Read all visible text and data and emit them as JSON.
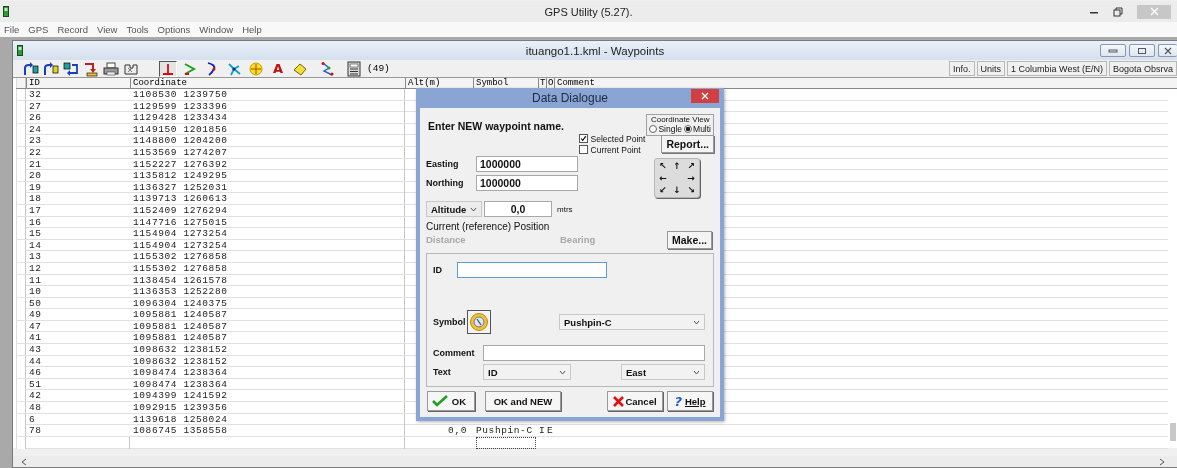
{
  "app": {
    "title": "GPS Utility (5.27).",
    "menu": [
      "File",
      "GPS",
      "Record",
      "View",
      "Tools",
      "Options",
      "Window",
      "Help"
    ]
  },
  "document": {
    "title": "ituango1.1.kml - Waypoints",
    "toolbar": {
      "modes": [
        {
          "kind": "waypoint",
          "selected": true
        },
        {
          "kind": "route",
          "selected": false
        },
        {
          "kind": "track",
          "selected": false
        },
        {
          "kind": "network",
          "selected": false
        },
        {
          "kind": "target",
          "selected": false
        },
        {
          "kind": "text",
          "label": "A",
          "selected": false
        },
        {
          "kind": "area",
          "selected": false
        }
      ],
      "count": "(49)",
      "info_buttons": [
        "Info.",
        "Units",
        "1 Columbia West (E/N)",
        "Bogota Obsrva"
      ]
    },
    "table": {
      "columns": [
        "ID",
        "Coordinate",
        "Alt(m)",
        "Symbol",
        "T",
        "O",
        "Comment"
      ],
      "rows": [
        {
          "id": "32",
          "coordinate": "1108530 1239750"
        },
        {
          "id": "27",
          "coordinate": "1129599 1233396"
        },
        {
          "id": "26",
          "coordinate": "1129428 1233434"
        },
        {
          "id": "24",
          "coordinate": "1149150 1201856"
        },
        {
          "id": "23",
          "coordinate": "1148800 1204200"
        },
        {
          "id": "22",
          "coordinate": "1153569 1274207"
        },
        {
          "id": "21",
          "coordinate": "1152227 1276392"
        },
        {
          "id": "20",
          "coordinate": "1135812 1249295"
        },
        {
          "id": "19",
          "coordinate": "1136327 1252031"
        },
        {
          "id": "18",
          "coordinate": "1139713 1260613"
        },
        {
          "id": "17",
          "coordinate": "1152409 1276294"
        },
        {
          "id": "16",
          "coordinate": "1147716 1275015"
        },
        {
          "id": "15",
          "coordinate": "1154904 1273254"
        },
        {
          "id": "14",
          "coordinate": "1154904 1273254"
        },
        {
          "id": "13",
          "coordinate": "1155302 1276858"
        },
        {
          "id": "12",
          "coordinate": "1155302 1276858"
        },
        {
          "id": "11",
          "coordinate": "1138454 1261578"
        },
        {
          "id": "10",
          "coordinate": "1136353 1252280"
        },
        {
          "id": "50",
          "coordinate": "1096304 1240375"
        },
        {
          "id": "49",
          "coordinate": "1095881 1240587"
        },
        {
          "id": "47",
          "coordinate": "1095881 1240587"
        },
        {
          "id": "41",
          "coordinate": "1095881 1240587"
        },
        {
          "id": "43",
          "coordinate": "1098632 1238152"
        },
        {
          "id": "44",
          "coordinate": "1098632 1238152"
        },
        {
          "id": "46",
          "coordinate": "1098474 1238364"
        },
        {
          "id": "51",
          "coordinate": "1098474 1238364"
        },
        {
          "id": "42",
          "coordinate": "1094399 1241592"
        },
        {
          "id": "48",
          "coordinate": "1092915 1239356"
        },
        {
          "id": "6",
          "coordinate": "1139618 1258024"
        },
        {
          "id": "78",
          "coordinate": "1086745 1358558",
          "alt": "0,0",
          "symbol": "Pushpin-C",
          "t": "I",
          "o": "E"
        }
      ]
    }
  },
  "dialog": {
    "title": "Data Dialogue",
    "prompt": "Enter NEW waypoint name.",
    "coordinate_view": {
      "label": "Coordinate View",
      "options": [
        {
          "label": "Single",
          "selected": false
        },
        {
          "label": "Multi",
          "selected": true
        }
      ]
    },
    "checkboxes": [
      {
        "label": "Selected Point",
        "checked": true
      },
      {
        "label": "Current Point",
        "checked": false
      }
    ],
    "report_button": "Report...",
    "easting": {
      "label": "Easting",
      "value": "1000000"
    },
    "northing": {
      "label": "Northing",
      "value": "1000000"
    },
    "arrow_pad": [
      "↖",
      "↑",
      "↗",
      "←",
      "→",
      "↙",
      "↓",
      "↘"
    ],
    "altitude": {
      "mode": "Altitude",
      "value": "0,0",
      "unit": "mtrs"
    },
    "reference": {
      "heading": "Current (reference) Position",
      "fields": [
        {
          "label": "Distance",
          "disabled": true
        },
        {
          "label": "Bearing",
          "disabled": true
        }
      ],
      "make_button": "Make..."
    },
    "id_field": {
      "label": "ID",
      "focused": true
    },
    "symbol": {
      "label": "Symbol",
      "value": "Pushpin-C"
    },
    "comment": {
      "label": "Comment"
    },
    "text": {
      "label": "Text",
      "value": "ID",
      "position": "East"
    },
    "buttons": [
      {
        "kind": "ok",
        "label": "OK"
      },
      {
        "kind": "ok_new",
        "label": "OK and NEW"
      },
      {
        "kind": "cancel",
        "label": "Cancel"
      },
      {
        "kind": "help",
        "label": "Help",
        "glyph": "?"
      }
    ]
  }
}
